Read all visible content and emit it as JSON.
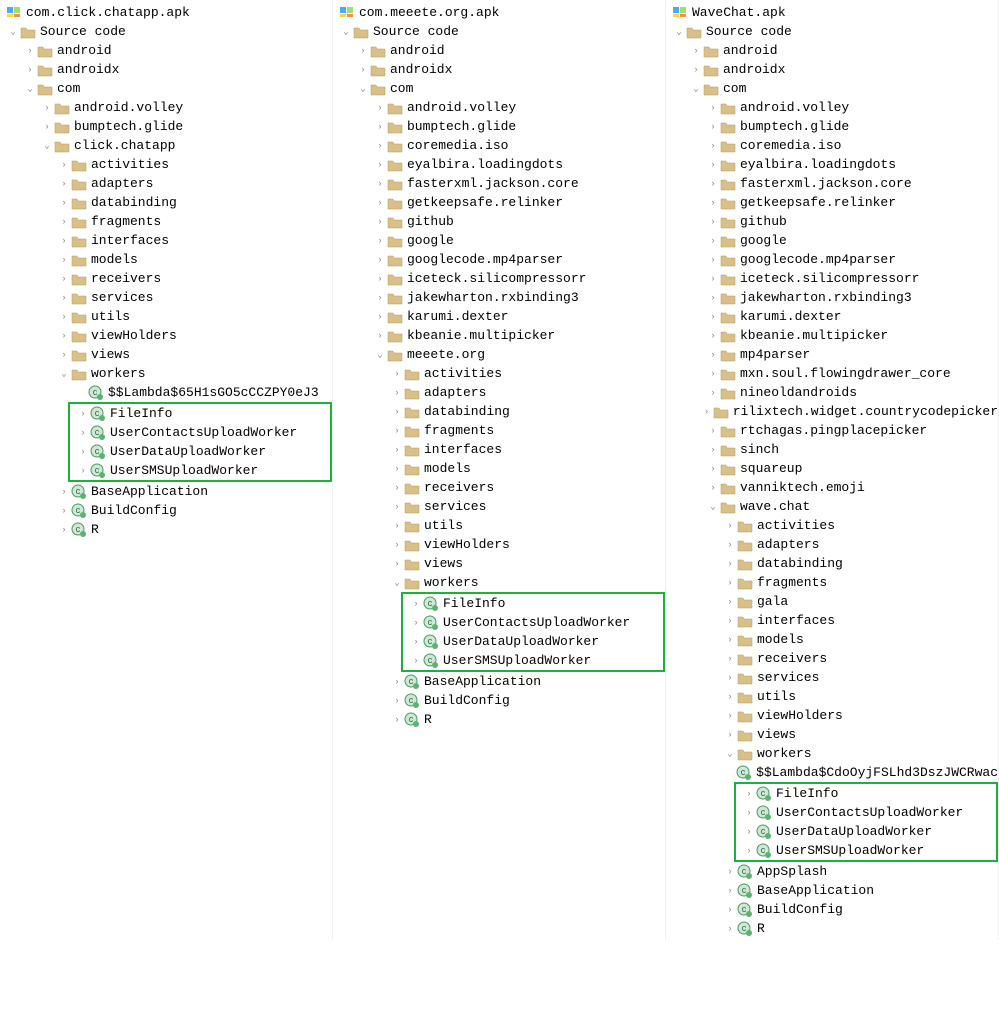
{
  "colors": {
    "highlight": "#18b23c"
  },
  "panels": [
    {
      "root": "com.click.chatapp.apk",
      "tree": [
        {
          "d": 0,
          "k": "folder",
          "a": "open",
          "t": "Source code"
        },
        {
          "d": 1,
          "k": "folder",
          "a": "closed",
          "t": "android"
        },
        {
          "d": 1,
          "k": "folder",
          "a": "closed",
          "t": "androidx"
        },
        {
          "d": 1,
          "k": "folder",
          "a": "open",
          "t": "com"
        },
        {
          "d": 2,
          "k": "folder",
          "a": "closed",
          "t": "android.volley"
        },
        {
          "d": 2,
          "k": "folder",
          "a": "closed",
          "t": "bumptech.glide"
        },
        {
          "d": 2,
          "k": "folder",
          "a": "open",
          "t": "click.chatapp"
        },
        {
          "d": 3,
          "k": "folder",
          "a": "closed",
          "t": "activities"
        },
        {
          "d": 3,
          "k": "folder",
          "a": "closed",
          "t": "adapters"
        },
        {
          "d": 3,
          "k": "folder",
          "a": "closed",
          "t": "databinding"
        },
        {
          "d": 3,
          "k": "folder",
          "a": "closed",
          "t": "fragments"
        },
        {
          "d": 3,
          "k": "folder",
          "a": "closed",
          "t": "interfaces"
        },
        {
          "d": 3,
          "k": "folder",
          "a": "closed",
          "t": "models"
        },
        {
          "d": 3,
          "k": "folder",
          "a": "closed",
          "t": "receivers"
        },
        {
          "d": 3,
          "k": "folder",
          "a": "closed",
          "t": "services"
        },
        {
          "d": 3,
          "k": "folder",
          "a": "closed",
          "t": "utils"
        },
        {
          "d": 3,
          "k": "folder",
          "a": "closed",
          "t": "viewHolders"
        },
        {
          "d": 3,
          "k": "folder",
          "a": "closed",
          "t": "views"
        },
        {
          "d": 3,
          "k": "folder",
          "a": "open",
          "t": "workers"
        },
        {
          "d": 4,
          "k": "class",
          "a": "none",
          "t": "$$Lambda$65H1sGO5cCCZPY0eJ3"
        },
        {
          "d": 4,
          "k": "class",
          "a": "closed",
          "t": "FileInfo",
          "hl": "start"
        },
        {
          "d": 4,
          "k": "class",
          "a": "closed",
          "t": "UserContactsUploadWorker"
        },
        {
          "d": 4,
          "k": "class",
          "a": "closed",
          "t": "UserDataUploadWorker"
        },
        {
          "d": 4,
          "k": "class",
          "a": "closed",
          "t": "UserSMSUploadWorker",
          "hl": "end"
        },
        {
          "d": 3,
          "k": "class",
          "a": "closed",
          "t": "BaseApplication"
        },
        {
          "d": 3,
          "k": "class",
          "a": "closed",
          "t": "BuildConfig"
        },
        {
          "d": 3,
          "k": "class",
          "a": "closed",
          "t": "R"
        }
      ]
    },
    {
      "root": "com.meeete.org.apk",
      "tree": [
        {
          "d": 0,
          "k": "folder",
          "a": "open",
          "t": "Source code"
        },
        {
          "d": 1,
          "k": "folder",
          "a": "closed",
          "t": "android"
        },
        {
          "d": 1,
          "k": "folder",
          "a": "closed",
          "t": "androidx"
        },
        {
          "d": 1,
          "k": "folder",
          "a": "open",
          "t": "com"
        },
        {
          "d": 2,
          "k": "folder",
          "a": "closed",
          "t": "android.volley"
        },
        {
          "d": 2,
          "k": "folder",
          "a": "closed",
          "t": "bumptech.glide"
        },
        {
          "d": 2,
          "k": "folder",
          "a": "closed",
          "t": "coremedia.iso"
        },
        {
          "d": 2,
          "k": "folder",
          "a": "closed",
          "t": "eyalbira.loadingdots"
        },
        {
          "d": 2,
          "k": "folder",
          "a": "closed",
          "t": "fasterxml.jackson.core"
        },
        {
          "d": 2,
          "k": "folder",
          "a": "closed",
          "t": "getkeepsafe.relinker"
        },
        {
          "d": 2,
          "k": "folder",
          "a": "closed",
          "t": "github"
        },
        {
          "d": 2,
          "k": "folder",
          "a": "closed",
          "t": "google"
        },
        {
          "d": 2,
          "k": "folder",
          "a": "closed",
          "t": "googlecode.mp4parser"
        },
        {
          "d": 2,
          "k": "folder",
          "a": "closed",
          "t": "iceteck.silicompressorr"
        },
        {
          "d": 2,
          "k": "folder",
          "a": "closed",
          "t": "jakewharton.rxbinding3"
        },
        {
          "d": 2,
          "k": "folder",
          "a": "closed",
          "t": "karumi.dexter"
        },
        {
          "d": 2,
          "k": "folder",
          "a": "closed",
          "t": "kbeanie.multipicker"
        },
        {
          "d": 2,
          "k": "folder",
          "a": "open",
          "t": "meeete.org"
        },
        {
          "d": 3,
          "k": "folder",
          "a": "closed",
          "t": "activities"
        },
        {
          "d": 3,
          "k": "folder",
          "a": "closed",
          "t": "adapters"
        },
        {
          "d": 3,
          "k": "folder",
          "a": "closed",
          "t": "databinding"
        },
        {
          "d": 3,
          "k": "folder",
          "a": "closed",
          "t": "fragments"
        },
        {
          "d": 3,
          "k": "folder",
          "a": "closed",
          "t": "interfaces"
        },
        {
          "d": 3,
          "k": "folder",
          "a": "closed",
          "t": "models"
        },
        {
          "d": 3,
          "k": "folder",
          "a": "closed",
          "t": "receivers"
        },
        {
          "d": 3,
          "k": "folder",
          "a": "closed",
          "t": "services"
        },
        {
          "d": 3,
          "k": "folder",
          "a": "closed",
          "t": "utils"
        },
        {
          "d": 3,
          "k": "folder",
          "a": "closed",
          "t": "viewHolders"
        },
        {
          "d": 3,
          "k": "folder",
          "a": "closed",
          "t": "views"
        },
        {
          "d": 3,
          "k": "folder",
          "a": "open",
          "t": "workers"
        },
        {
          "d": 4,
          "k": "class",
          "a": "closed",
          "t": "FileInfo",
          "hl": "start"
        },
        {
          "d": 4,
          "k": "class",
          "a": "closed",
          "t": "UserContactsUploadWorker"
        },
        {
          "d": 4,
          "k": "class",
          "a": "closed",
          "t": "UserDataUploadWorker"
        },
        {
          "d": 4,
          "k": "class",
          "a": "closed",
          "t": "UserSMSUploadWorker",
          "hl": "end"
        },
        {
          "d": 3,
          "k": "class",
          "a": "closed",
          "t": "BaseApplication"
        },
        {
          "d": 3,
          "k": "class",
          "a": "closed",
          "t": "BuildConfig"
        },
        {
          "d": 3,
          "k": "class",
          "a": "closed",
          "t": "R"
        }
      ]
    },
    {
      "root": "WaveChat.apk",
      "tree": [
        {
          "d": 0,
          "k": "folder",
          "a": "open",
          "t": "Source code"
        },
        {
          "d": 1,
          "k": "folder",
          "a": "closed",
          "t": "android"
        },
        {
          "d": 1,
          "k": "folder",
          "a": "closed",
          "t": "androidx"
        },
        {
          "d": 1,
          "k": "folder",
          "a": "open",
          "t": "com"
        },
        {
          "d": 2,
          "k": "folder",
          "a": "closed",
          "t": "android.volley"
        },
        {
          "d": 2,
          "k": "folder",
          "a": "closed",
          "t": "bumptech.glide"
        },
        {
          "d": 2,
          "k": "folder",
          "a": "closed",
          "t": "coremedia.iso"
        },
        {
          "d": 2,
          "k": "folder",
          "a": "closed",
          "t": "eyalbira.loadingdots"
        },
        {
          "d": 2,
          "k": "folder",
          "a": "closed",
          "t": "fasterxml.jackson.core"
        },
        {
          "d": 2,
          "k": "folder",
          "a": "closed",
          "t": "getkeepsafe.relinker"
        },
        {
          "d": 2,
          "k": "folder",
          "a": "closed",
          "t": "github"
        },
        {
          "d": 2,
          "k": "folder",
          "a": "closed",
          "t": "google"
        },
        {
          "d": 2,
          "k": "folder",
          "a": "closed",
          "t": "googlecode.mp4parser"
        },
        {
          "d": 2,
          "k": "folder",
          "a": "closed",
          "t": "iceteck.silicompressorr"
        },
        {
          "d": 2,
          "k": "folder",
          "a": "closed",
          "t": "jakewharton.rxbinding3"
        },
        {
          "d": 2,
          "k": "folder",
          "a": "closed",
          "t": "karumi.dexter"
        },
        {
          "d": 2,
          "k": "folder",
          "a": "closed",
          "t": "kbeanie.multipicker"
        },
        {
          "d": 2,
          "k": "folder",
          "a": "closed",
          "t": "mp4parser"
        },
        {
          "d": 2,
          "k": "folder",
          "a": "closed",
          "t": "mxn.soul.flowingdrawer_core"
        },
        {
          "d": 2,
          "k": "folder",
          "a": "closed",
          "t": "nineoldandroids"
        },
        {
          "d": 2,
          "k": "folder",
          "a": "closed",
          "t": "rilixtech.widget.countrycodepicker"
        },
        {
          "d": 2,
          "k": "folder",
          "a": "closed",
          "t": "rtchagas.pingplacepicker"
        },
        {
          "d": 2,
          "k": "folder",
          "a": "closed",
          "t": "sinch"
        },
        {
          "d": 2,
          "k": "folder",
          "a": "closed",
          "t": "squareup"
        },
        {
          "d": 2,
          "k": "folder",
          "a": "closed",
          "t": "vanniktech.emoji"
        },
        {
          "d": 2,
          "k": "folder",
          "a": "open",
          "t": "wave.chat"
        },
        {
          "d": 3,
          "k": "folder",
          "a": "closed",
          "t": "activities"
        },
        {
          "d": 3,
          "k": "folder",
          "a": "closed",
          "t": "adapters"
        },
        {
          "d": 3,
          "k": "folder",
          "a": "closed",
          "t": "databinding"
        },
        {
          "d": 3,
          "k": "folder",
          "a": "closed",
          "t": "fragments"
        },
        {
          "d": 3,
          "k": "folder",
          "a": "closed",
          "t": "gala"
        },
        {
          "d": 3,
          "k": "folder",
          "a": "closed",
          "t": "interfaces"
        },
        {
          "d": 3,
          "k": "folder",
          "a": "closed",
          "t": "models"
        },
        {
          "d": 3,
          "k": "folder",
          "a": "closed",
          "t": "receivers"
        },
        {
          "d": 3,
          "k": "folder",
          "a": "closed",
          "t": "services"
        },
        {
          "d": 3,
          "k": "folder",
          "a": "closed",
          "t": "utils"
        },
        {
          "d": 3,
          "k": "folder",
          "a": "closed",
          "t": "viewHolders"
        },
        {
          "d": 3,
          "k": "folder",
          "a": "closed",
          "t": "views"
        },
        {
          "d": 3,
          "k": "folder",
          "a": "open",
          "t": "workers"
        },
        {
          "d": 4,
          "k": "class",
          "a": "none",
          "t": "$$Lambda$CdoOyjFSLhd3DszJWCRwac"
        },
        {
          "d": 4,
          "k": "class",
          "a": "closed",
          "t": "FileInfo",
          "hl": "start"
        },
        {
          "d": 4,
          "k": "class",
          "a": "closed",
          "t": "UserContactsUploadWorker"
        },
        {
          "d": 4,
          "k": "class",
          "a": "closed",
          "t": "UserDataUploadWorker"
        },
        {
          "d": 4,
          "k": "class",
          "a": "closed",
          "t": "UserSMSUploadWorker",
          "hl": "end"
        },
        {
          "d": 3,
          "k": "class",
          "a": "closed",
          "t": "AppSplash"
        },
        {
          "d": 3,
          "k": "class",
          "a": "closed",
          "t": "BaseApplication"
        },
        {
          "d": 3,
          "k": "class",
          "a": "closed",
          "t": "BuildConfig"
        },
        {
          "d": 3,
          "k": "class",
          "a": "closed",
          "t": "R"
        }
      ]
    }
  ]
}
